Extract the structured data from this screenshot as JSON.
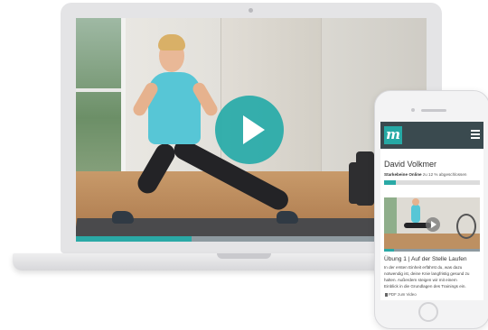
{
  "desktop": {
    "video": {
      "play_icon": "play-icon",
      "progress_fraction": 0.33,
      "accent_color": "#2aa9a6"
    }
  },
  "mobile": {
    "header": {
      "logo_text": "m",
      "logo_color": "#26a9a5",
      "menu_icon": "hamburger-menu-icon"
    },
    "user_name": "David Volkmer",
    "course": {
      "name": "Starkebeine Online",
      "status_text": "zu 12 % abgeschlossen",
      "progress_percent": 12
    },
    "lesson": {
      "video_progress_fraction": 0.1,
      "title": "Übung 1 | Auf der Stelle Laufen",
      "body_lines": [
        "In der ersten Einheit erfährst du, was dazu",
        "notwendig ist, deine Knie langfristig gesund zu",
        "halten. Außerdem steigen wir mit einem",
        "Einblick in die Grundlagen des Trainings ein."
      ],
      "pdf_label": "PDF zum Video"
    }
  }
}
